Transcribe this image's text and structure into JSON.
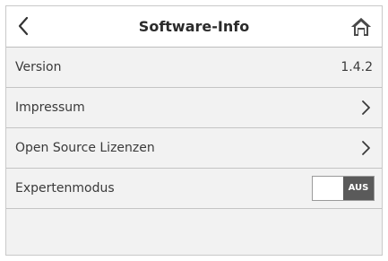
{
  "header": {
    "title": "Software-Info",
    "back_icon": "chevron-left-icon",
    "home_icon": "home-icon"
  },
  "rows": [
    {
      "label": "Version",
      "value": "1.4.2"
    },
    {
      "label": "Impressum",
      "icon": "chevron-right-icon"
    },
    {
      "label": "Open Source Lizenzen",
      "icon": "chevron-right-icon"
    },
    {
      "label": "Expertenmodus",
      "toggle_state": "AUS"
    }
  ],
  "colors": {
    "background": "#f2f2f2",
    "header_bg": "#ffffff",
    "toggle_off": "#5a5a5a"
  }
}
